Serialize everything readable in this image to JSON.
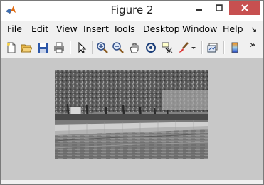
{
  "window": {
    "title": "Figure 2"
  },
  "menu": {
    "items": [
      "File",
      "Edit",
      "View",
      "Insert",
      "Tools",
      "Desktop",
      "Window",
      "Help"
    ],
    "overflow": "↘"
  },
  "toolbar": {
    "icons": [
      "new-figure-icon",
      "open-file-icon",
      "save-icon",
      "print-icon",
      "pointer-icon",
      "zoom-in-icon",
      "zoom-out-icon",
      "pan-hand-icon",
      "rotate-3d-icon",
      "data-cursor-icon",
      "brush-icon",
      "dropdown-arrow-icon",
      "link-plot-icon",
      "colorbar-icon",
      "overflow-chevrons-icon"
    ],
    "overflow": "»"
  },
  "colors": {
    "close_button": "#c75050",
    "canvas_background": "#c8c8c8",
    "window_background": "#f0f0f0"
  },
  "figure": {
    "content": "grayscale photograph of a tree-lined river embankment"
  }
}
